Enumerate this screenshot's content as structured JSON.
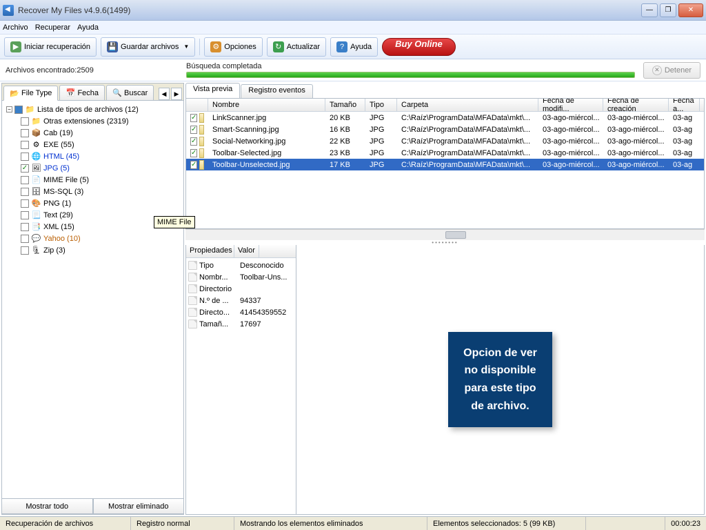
{
  "title": "Recover My Files v4.9.6(1499)",
  "menu": {
    "archivo": "Archivo",
    "recuperar": "Recuperar",
    "ayuda": "Ayuda"
  },
  "toolbar": {
    "start": "Iniciar recuperación",
    "save": "Guardar archivos",
    "options": "Opciones",
    "refresh": "Actualizar",
    "help": "Ayuda",
    "buy": "Buy Online"
  },
  "status": {
    "found_label": "Archivos encontrado:2509",
    "search_label": "Búsqueda completada",
    "stop": "Detener"
  },
  "left_tabs": {
    "file_type": "File Type",
    "fecha": "Fecha",
    "buscar": "Buscar"
  },
  "tooltip": "MIME File",
  "tree": {
    "root": "Lista de tipos de archivos (12)",
    "items": [
      {
        "label": "Otras extensiones (2319)",
        "checked": false,
        "icon": "📁",
        "color": ""
      },
      {
        "label": "Cab (19)",
        "checked": false,
        "icon": "📦",
        "color": ""
      },
      {
        "label": "EXE (55)",
        "checked": false,
        "icon": "⚙",
        "color": ""
      },
      {
        "label": "HTML (45)",
        "checked": false,
        "icon": "🌐",
        "color": "#0030d0"
      },
      {
        "label": "JPG (5)",
        "checked": true,
        "icon": "🖼",
        "color": "#0030d0"
      },
      {
        "label": "MIME File (5)",
        "checked": false,
        "icon": "📄",
        "color": ""
      },
      {
        "label": "MS-SQL (3)",
        "checked": false,
        "icon": "🗄",
        "color": ""
      },
      {
        "label": "PNG (1)",
        "checked": false,
        "icon": "🎨",
        "color": ""
      },
      {
        "label": "Text (29)",
        "checked": false,
        "icon": "📃",
        "color": ""
      },
      {
        "label": "XML (15)",
        "checked": false,
        "icon": "📑",
        "color": ""
      },
      {
        "label": "Yahoo (10)",
        "checked": false,
        "icon": "💬",
        "color": "#ba5e00"
      },
      {
        "label": "Zip (3)",
        "checked": false,
        "icon": "🗜",
        "color": ""
      }
    ]
  },
  "left_bottom": {
    "all": "Mostrar todo",
    "deleted": "Mostrar eliminado"
  },
  "right_tabs": {
    "preview": "Vista previa",
    "events": "Registro eventos"
  },
  "cols": {
    "name": "Nombre",
    "size": "Tamaño",
    "type": "Tipo",
    "folder": "Carpeta",
    "mod": "Fecha de modifi...",
    "cre": "Fecha de creación",
    "acc": "Fecha a..."
  },
  "files": [
    {
      "name": "LinkScanner.jpg",
      "size": "20 KB",
      "type": "JPG",
      "folder": "C:\\Raíz\\ProgramData\\MFAData\\mkt\\...",
      "mod": "03-ago-miércol...",
      "cre": "03-ago-miércol...",
      "acc": "03-ag",
      "sel": false
    },
    {
      "name": "Smart-Scanning.jpg",
      "size": "16 KB",
      "type": "JPG",
      "folder": "C:\\Raíz\\ProgramData\\MFAData\\mkt\\...",
      "mod": "03-ago-miércol...",
      "cre": "03-ago-miércol...",
      "acc": "03-ag",
      "sel": false
    },
    {
      "name": "Social-Networking.jpg",
      "size": "22 KB",
      "type": "JPG",
      "folder": "C:\\Raíz\\ProgramData\\MFAData\\mkt\\...",
      "mod": "03-ago-miércol...",
      "cre": "03-ago-miércol...",
      "acc": "03-ag",
      "sel": false
    },
    {
      "name": "Toolbar-Selected.jpg",
      "size": "23 KB",
      "type": "JPG",
      "folder": "C:\\Raíz\\ProgramData\\MFAData\\mkt\\...",
      "mod": "03-ago-miércol...",
      "cre": "03-ago-miércol...",
      "acc": "03-ag",
      "sel": false
    },
    {
      "name": "Toolbar-Unselected.jpg",
      "size": "17 KB",
      "type": "JPG",
      "folder": "C:\\Raíz\\ProgramData\\MFAData\\mkt\\...",
      "mod": "03-ago-miércol...",
      "cre": "03-ago-miércol...",
      "acc": "03-ag",
      "sel": true
    }
  ],
  "props_hdr": {
    "prop": "Propiedades",
    "val": "Valor"
  },
  "props": [
    {
      "k": "Tipo",
      "v": "Desconocido"
    },
    {
      "k": "Nombr...",
      "v": "Toolbar-Uns..."
    },
    {
      "k": "Directorio",
      "v": ""
    },
    {
      "k": "N.º de ...",
      "v": "94337"
    },
    {
      "k": "Directo...",
      "v": "41454359552"
    },
    {
      "k": "Tamañ...",
      "v": "17697"
    }
  ],
  "preview_msg": "Opcion de ver\nno disponible\npara este tipo\nde archivo.",
  "statusbar": {
    "a": "Recuperación de archivos",
    "b": "Registro normal",
    "c": "Mostrando los elementos eliminados",
    "d": "Elementos seleccionados: 5 (99 KB)",
    "time": "00:00:23"
  }
}
